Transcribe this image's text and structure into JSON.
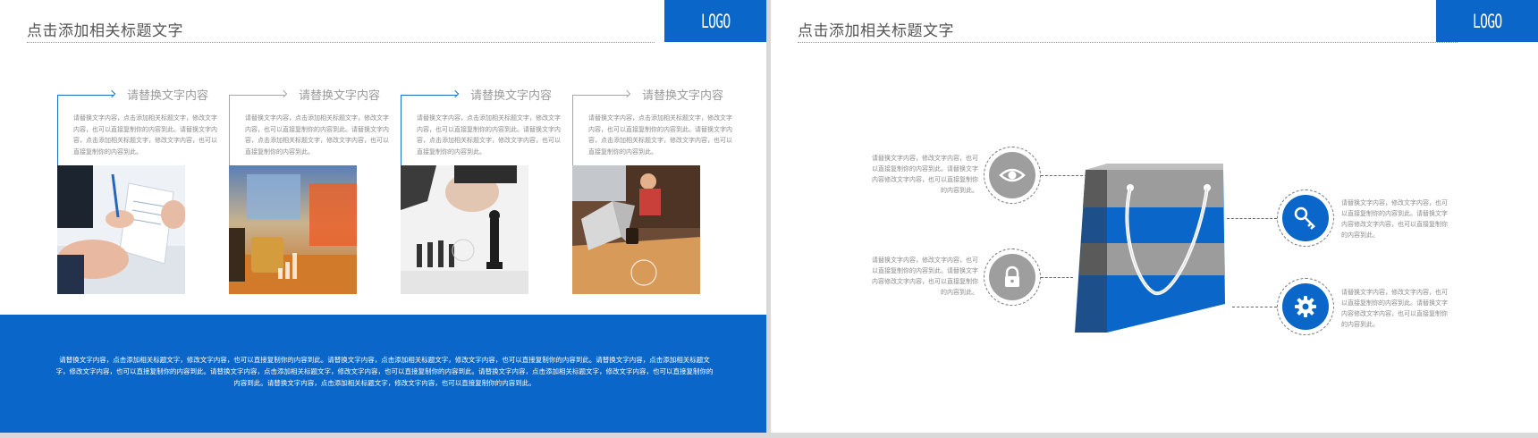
{
  "left_slide": {
    "title": "点击添加相关标题文字",
    "logo": "LOGO",
    "cards": [
      {
        "title": "请替换文字内容",
        "text": "请替换文字内容，点击添加相关标题文字，修改文字内容，也可以直接复制你的内容到此。请替换文字内容，点击添加相关标题文字，修改文字内容，也可以直接复制你的内容到此。"
      },
      {
        "title": "请替换文字内容",
        "text": "请替换文字内容，点击添加相关标题文字，修改文字内容，也可以直接复制你的内容到此。请替换文字内容，点击添加相关标题文字，修改文字内容，也可以直接复制你的内容到此。"
      },
      {
        "title": "请替换文字内容",
        "text": "请替换文字内容，点击添加相关标题文字，修改文字内容，也可以直接复制你的内容到此。请替换文字内容，点击添加相关标题文字，修改文字内容，也可以直接复制你的内容到此。"
      },
      {
        "title": "请替换文字内容",
        "text": "请替换文字内容，点击添加相关标题文字，修改文字内容，也可以直接复制你的内容到此。请替换文字内容，点击添加相关标题文字，修改文字内容，也可以直接复制你的内容到此。"
      }
    ],
    "band_text": "请替换文字内容，点击添加相关标题文字，修改文字内容，也可以直接复制你的内容到此。请替换文字内容，点击添加相关标题文字，修改文字内容，也可以直接复制你的内容到此。请替换文字内容，点击添加相关标题文字，修改文字内容，也可以直接复制你的内容到此。请替换文字内容，点击添加相关标题文字，修改文字内容，也可以直接复制你的内容到此。请替换文字内容，点击添加相关标题文字，修改文字内容，也可以直接复制你的内容到此。请替换文字内容，点击添加相关标题文字，修改文字内容，也可以直接复制你的内容到此。",
    "accent_color": "#0a66c8"
  },
  "right_slide": {
    "title": "点击添加相关标题文字",
    "logo": "LOGO",
    "items": [
      {
        "icon": "eye-icon",
        "text": "请替换文字内容，修改文字内容，也可以直接复制你的内容到此。请替换文字内容修改文字内容，也可以直接复制你的内容到此。"
      },
      {
        "icon": "lock-icon",
        "text": "请替换文字内容，修改文字内容，也可以直接复制你的内容到此。请替换文字内容修改文字内容，也可以直接复制你的内容到此。"
      },
      {
        "icon": "key-icon",
        "text": "请替换文字内容，修改文字内容，也可以直接复制你的内容到此。请替换文字内容修改文字内容，也可以直接复制你的内容到此。"
      },
      {
        "icon": "gear-icon",
        "text": "请替换文字内容，修改文字内容，也可以直接复制你的内容到此。请替换文字内容修改文字内容，也可以直接复制你的内容到此。"
      }
    ],
    "colors": {
      "blue": "#0a66c8",
      "gray": "#9e9e9e"
    }
  }
}
